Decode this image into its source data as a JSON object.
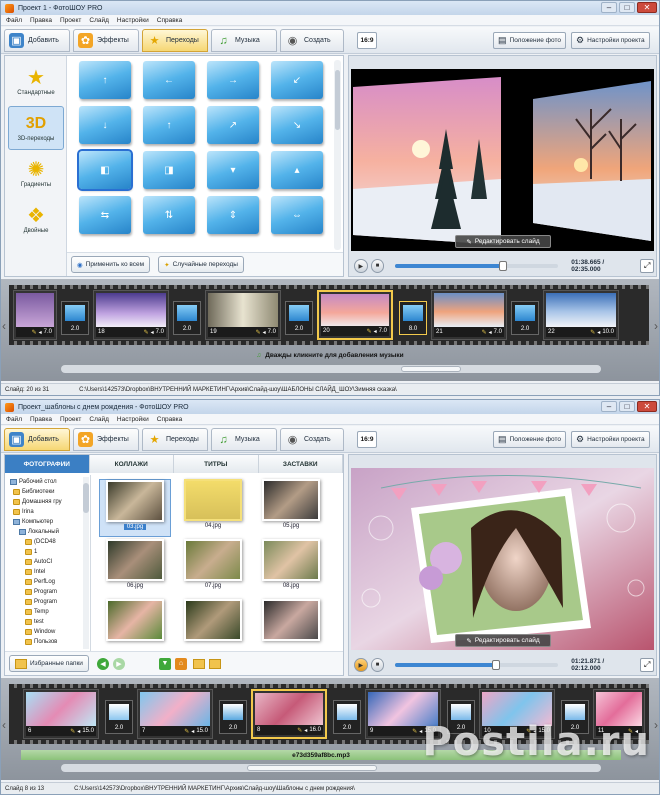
{
  "window1": {
    "title": "Проект 1 - ФотоШОУ PRO",
    "menu": [
      "Файл",
      "Правка",
      "Проект",
      "Слайд",
      "Настройки",
      "Справка"
    ],
    "tabs": [
      "Добавить",
      "Эффекты",
      "Переходы",
      "Музыка",
      "Создать"
    ],
    "active_tab": "Переходы",
    "ratio": "16:9",
    "photo_position_label": "Положение фото",
    "project_settings_label": "Настройки проекта",
    "categories": [
      "Стандартные",
      "3D-переходы",
      "Градиенты",
      "Двойные"
    ],
    "active_category": "3D-переходы",
    "apply_all_label": "Применить ко всем",
    "random_label": "Случайные переходы",
    "edit_slide_label": "Редактировать слайд",
    "time": "01:38.665 / 02:35.000",
    "progress": 0.66,
    "slides": [
      {
        "num": "",
        "dur": "7.0"
      },
      {
        "num": "18",
        "dur": "7.0"
      },
      {
        "num": "19",
        "dur": "7.0"
      },
      {
        "num": "20",
        "dur": "7.0"
      },
      {
        "num": "21",
        "dur": "7.0"
      },
      {
        "num": "22",
        "dur": "10.0"
      }
    ],
    "transitions": [
      "2.0",
      "2.0",
      "2.0",
      "8.0",
      "2.0"
    ],
    "audio_hint": "Дважды кликните для добавления музыки",
    "status_slide": "Слайд: 20 из 31",
    "status_path": "C:\\Users\\142573\\Dropbox\\ВНУТРЕННИЙ МАРКЕТИНГ\\Архив\\Слайд-шоу\\ШАБЛОНЫ СЛАЙД_ШОУ\\Зимняя сказка\\"
  },
  "window2": {
    "title": "Проект_шаблоны с днем рождения - ФотоШОУ PRO",
    "menu": [
      "Файл",
      "Правка",
      "Проект",
      "Слайд",
      "Настройки",
      "Справка"
    ],
    "tabs": [
      "Добавить",
      "Эффекты",
      "Переходы",
      "Музыка",
      "Создать"
    ],
    "ratio": "16:9",
    "photo_position_label": "Положение фото",
    "project_settings_label": "Настройки проекта",
    "subtabs": [
      "ФОТОГРАФИИ",
      "КОЛЛАЖИ",
      "ТИТРЫ",
      "ЗАСТАВКИ"
    ],
    "tree": [
      "Рабочий стол",
      "Библиотеки",
      "Домашняя гру",
      "Irina",
      "Компьютер",
      "Локальный",
      "(DCD48",
      "1",
      "AutoCl",
      "Intel",
      "PerfLog",
      "Program",
      "Program",
      "Temp",
      "test",
      "Window",
      "Пользов"
    ],
    "files": [
      "03.jpg",
      "04.jpg",
      "05.jpg",
      "06.jpg",
      "07.jpg",
      "08.jpg",
      "",
      "",
      ""
    ],
    "favorites_label": "Избранные папки",
    "edit_slide_label": "Редактировать слайд",
    "time": "01:21.871 / 02:12.000",
    "progress": 0.62,
    "slides": [
      {
        "num": "6",
        "dur": "15.0"
      },
      {
        "num": "7",
        "dur": "15.0"
      },
      {
        "num": "8",
        "dur": "16.0"
      },
      {
        "num": "9",
        "dur": "15.0"
      },
      {
        "num": "10",
        "dur": "15.0"
      },
      {
        "num": "11",
        "dur": ""
      }
    ],
    "transitions": [
      "2.0",
      "2.0",
      "2.0",
      "2.0",
      "2.0"
    ],
    "audio_file": "e73d359af8bc.mp3",
    "status_slide": "Слайд 8 из 13",
    "status_path": "C:\\Users\\142573\\Dropbox\\ВНУТРЕННИЙ МАРКЕТИНГ\\Архив\\Слайд-шоу\\Шаблоны с днем рождения\\"
  },
  "watermark": "Postila.ru"
}
